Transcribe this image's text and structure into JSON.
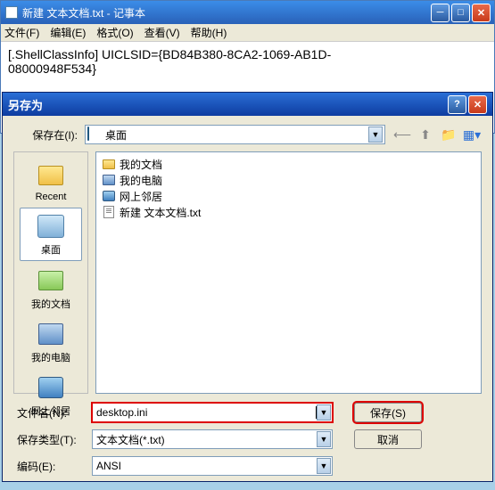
{
  "notepad": {
    "title": "新建 文本文档.txt - 记事本",
    "menu": {
      "file": "文件(F)",
      "edit": "编辑(E)",
      "format": "格式(O)",
      "view": "查看(V)",
      "help": "帮助(H)"
    },
    "content_line1": "[.ShellClassInfo] UICLSID={BD84B380-8CA2-1069-AB1D-",
    "content_line2": "08000948F534}"
  },
  "dialog": {
    "title": "另存为",
    "save_in_label": "保存在(I):",
    "save_in_value": "桌面",
    "places": {
      "recent": "Recent",
      "desktop": "桌面",
      "my_documents": "我的文档",
      "my_computer": "我的电脑",
      "network": "网上邻居"
    },
    "files": [
      {
        "icon": "folder",
        "name": "我的文档"
      },
      {
        "icon": "computer",
        "name": "我的电脑"
      },
      {
        "icon": "network",
        "name": "网上邻居"
      },
      {
        "icon": "txt",
        "name": "新建 文本文档.txt"
      }
    ],
    "filename_label": "文件名(N):",
    "filename_value": "desktop.ini",
    "filetype_label": "保存类型(T):",
    "filetype_value": "文本文档(*.txt)",
    "encoding_label": "编码(E):",
    "encoding_value": "ANSI",
    "save_button": "保存(S)",
    "cancel_button": "取消"
  }
}
